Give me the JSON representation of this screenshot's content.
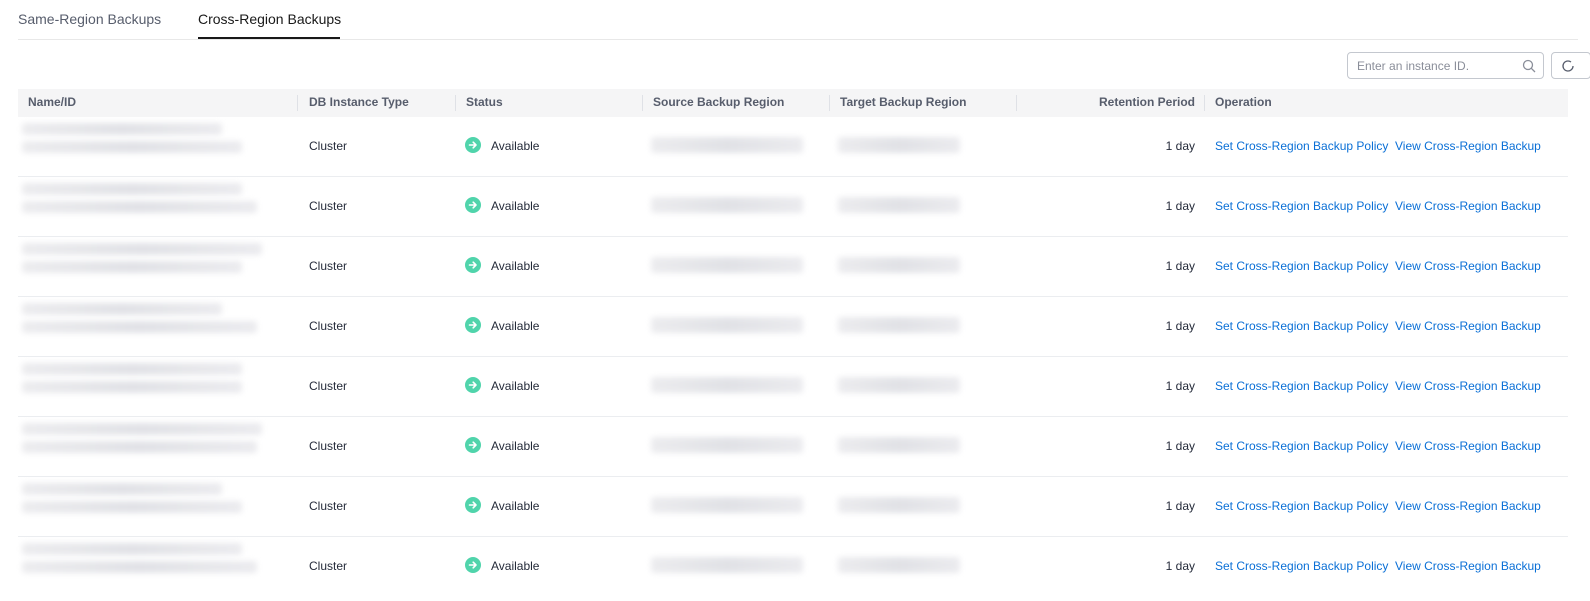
{
  "tabs": [
    {
      "label": "Same-Region Backups",
      "active": false
    },
    {
      "label": "Cross-Region Backups",
      "active": true
    }
  ],
  "search": {
    "placeholder": "Enter an instance ID.",
    "value": ""
  },
  "table": {
    "headers": [
      "Name/ID",
      "DB Instance Type",
      "Status",
      "Source Backup Region",
      "Target Backup Region",
      "Retention Period",
      "Operation"
    ],
    "rows": [
      {
        "type": "Cluster",
        "status": "Available",
        "retention": "1 day",
        "op_set": "Set Cross-Region Backup Policy",
        "op_view": "View Cross-Region Backup"
      },
      {
        "type": "Cluster",
        "status": "Available",
        "retention": "1 day",
        "op_set": "Set Cross-Region Backup Policy",
        "op_view": "View Cross-Region Backup"
      },
      {
        "type": "Cluster",
        "status": "Available",
        "retention": "1 day",
        "op_set": "Set Cross-Region Backup Policy",
        "op_view": "View Cross-Region Backup"
      },
      {
        "type": "Cluster",
        "status": "Available",
        "retention": "1 day",
        "op_set": "Set Cross-Region Backup Policy",
        "op_view": "View Cross-Region Backup"
      },
      {
        "type": "Cluster",
        "status": "Available",
        "retention": "1 day",
        "op_set": "Set Cross-Region Backup Policy",
        "op_view": "View Cross-Region Backup"
      },
      {
        "type": "Cluster",
        "status": "Available",
        "retention": "1 day",
        "op_set": "Set Cross-Region Backup Policy",
        "op_view": "View Cross-Region Backup"
      },
      {
        "type": "Cluster",
        "status": "Available",
        "retention": "1 day",
        "op_set": "Set Cross-Region Backup Policy",
        "op_view": "View Cross-Region Backup"
      },
      {
        "type": "Cluster",
        "status": "Available",
        "retention": "1 day",
        "op_set": "Set Cross-Region Backup Policy",
        "op_view": "View Cross-Region Backup"
      }
    ]
  },
  "icons": {
    "search": "search-icon",
    "refresh": "refresh-icon",
    "status": "status-available-icon"
  },
  "colors": {
    "link": "#0a6fd6",
    "status_available": "#50d4ab",
    "header_bg": "#f5f5f6",
    "active_tab": "#191919"
  }
}
